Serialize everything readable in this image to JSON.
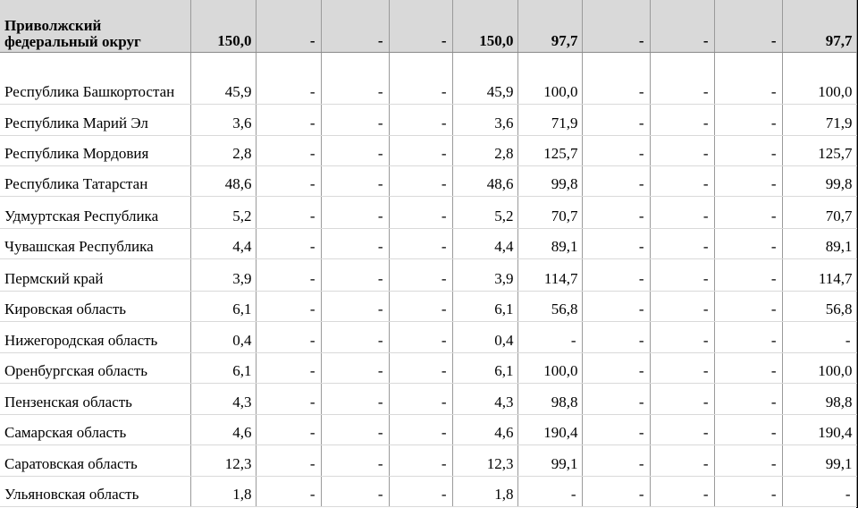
{
  "header": {
    "name": "Приволжский федеральный округ",
    "values": [
      "150,0",
      "-",
      "-",
      "-",
      "150,0",
      "97,7",
      "-",
      "-",
      "-",
      "97,7"
    ]
  },
  "rows": [
    {
      "name": "Республика Башкортостан",
      "values": [
        "45,9",
        "-",
        "-",
        "-",
        "45,9",
        "100,0",
        "-",
        "-",
        "-",
        "100,0"
      ]
    },
    {
      "name": "Республика Марий Эл",
      "values": [
        "3,6",
        "-",
        "-",
        "-",
        "3,6",
        "71,9",
        "-",
        "-",
        "-",
        "71,9"
      ]
    },
    {
      "name": "Республика Мордовия",
      "values": [
        "2,8",
        "-",
        "-",
        "-",
        "2,8",
        "125,7",
        "-",
        "-",
        "-",
        "125,7"
      ]
    },
    {
      "name": "Республика Татарстан",
      "values": [
        "48,6",
        "-",
        "-",
        "-",
        "48,6",
        "99,8",
        "-",
        "-",
        "-",
        "99,8"
      ]
    },
    {
      "name": "Удмуртская Республика",
      "values": [
        "5,2",
        "-",
        "-",
        "-",
        "5,2",
        "70,7",
        "-",
        "-",
        "-",
        "70,7"
      ]
    },
    {
      "name": "Чувашская Республика",
      "values": [
        "4,4",
        "-",
        "-",
        "-",
        "4,4",
        "89,1",
        "-",
        "-",
        "-",
        "89,1"
      ]
    },
    {
      "name": "Пермский край",
      "values": [
        "3,9",
        "-",
        "-",
        "-",
        "3,9",
        "114,7",
        "-",
        "-",
        "-",
        "114,7"
      ]
    },
    {
      "name": "Кировская область",
      "values": [
        "6,1",
        "-",
        "-",
        "-",
        "6,1",
        "56,8",
        "-",
        "-",
        "-",
        "56,8"
      ]
    },
    {
      "name": "Нижегородская область",
      "values": [
        "0,4",
        "-",
        "-",
        "-",
        "0,4",
        "-",
        "-",
        "-",
        "-",
        "-"
      ]
    },
    {
      "name": "Оренбургская область",
      "values": [
        "6,1",
        "-",
        "-",
        "-",
        "6,1",
        "100,0",
        "-",
        "-",
        "-",
        "100,0"
      ]
    },
    {
      "name": "Пензенская область",
      "values": [
        "4,3",
        "-",
        "-",
        "-",
        "4,3",
        "98,8",
        "-",
        "-",
        "-",
        "98,8"
      ]
    },
    {
      "name": "Самарская область",
      "values": [
        "4,6",
        "-",
        "-",
        "-",
        "4,6",
        "190,4",
        "-",
        "-",
        "-",
        "190,4"
      ]
    },
    {
      "name": "Саратовская область",
      "values": [
        "12,3",
        "-",
        "-",
        "-",
        "12,3",
        "99,1",
        "-",
        "-",
        "-",
        "99,1"
      ]
    },
    {
      "name": "Ульяновская область",
      "values": [
        "1,8",
        "-",
        "-",
        "-",
        "1,8",
        "-",
        "-",
        "-",
        "-",
        "-"
      ]
    }
  ]
}
